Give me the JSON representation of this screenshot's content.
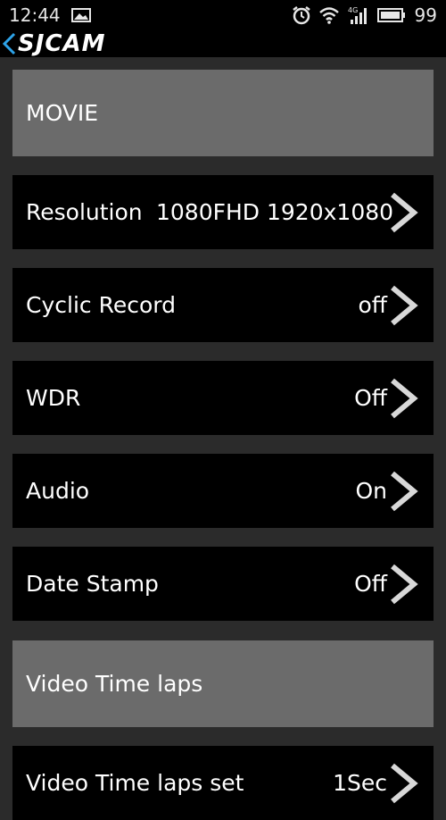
{
  "status_bar": {
    "time": "12:44",
    "network": "4G",
    "battery": "99"
  },
  "app_bar": {
    "logo": "SJCAM"
  },
  "sections": {
    "movie": "MOVIE",
    "timelapse": "Video Time laps"
  },
  "rows": [
    {
      "label": "Resolution",
      "value": "1080FHD 1920x1080"
    },
    {
      "label": "Cyclic Record",
      "value": "off"
    },
    {
      "label": "WDR",
      "value": "Off"
    },
    {
      "label": "Audio",
      "value": "On"
    },
    {
      "label": "Date Stamp",
      "value": "Off"
    },
    {
      "label": "Video Time laps set",
      "value": "1Sec"
    }
  ]
}
